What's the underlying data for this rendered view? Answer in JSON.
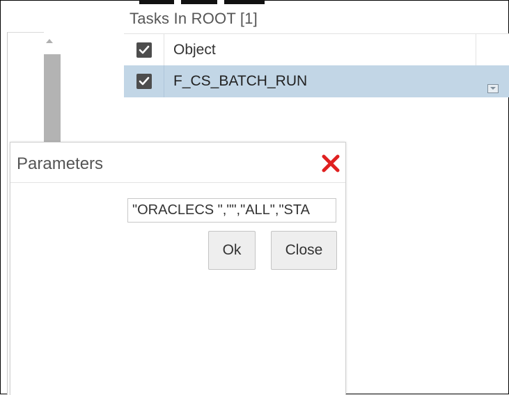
{
  "tasks_panel": {
    "title": "Tasks In ROOT [1]",
    "columns": [
      "",
      "Object",
      ""
    ],
    "rows": [
      {
        "checked": true,
        "object": "F_CS_BATCH_RUN"
      }
    ]
  },
  "parameters_dialog": {
    "title": "Parameters",
    "input_value": "\"ORACLECS  \",\"\",\"ALL\",\"STA",
    "ok_label": "Ok",
    "close_label": "Close"
  },
  "colors": {
    "selected_row": "#c2d6e6",
    "close_icon": "#e02020",
    "checkbox": "#4d4d4d"
  },
  "icons": {
    "close": "close-x-icon",
    "checkbox": "checkbox-checked-icon",
    "scroll_up": "chevron-up-icon",
    "row_action": "dropdown-icon"
  }
}
